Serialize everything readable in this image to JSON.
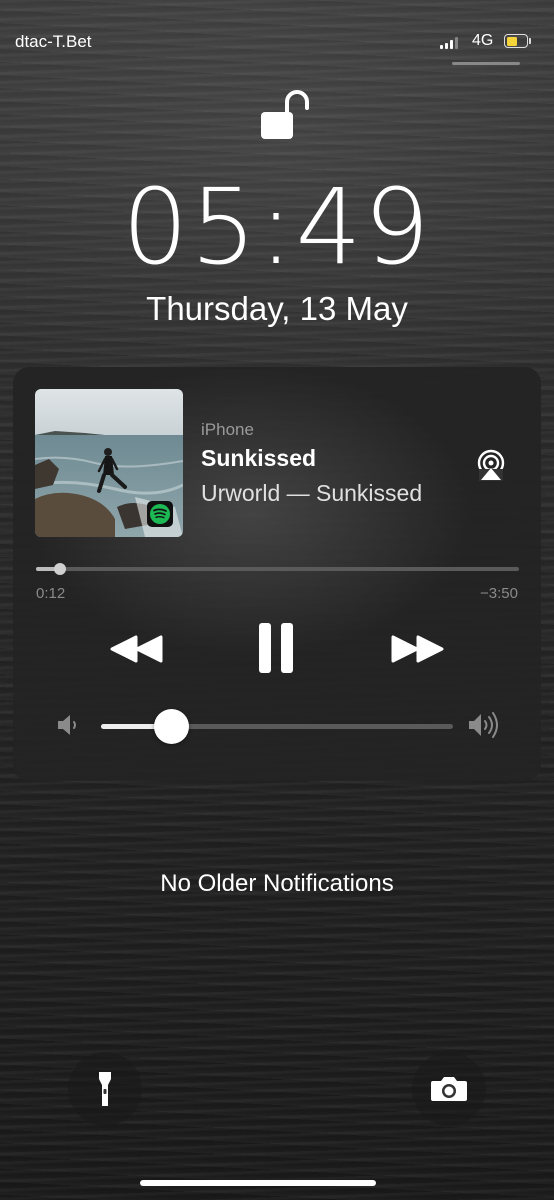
{
  "status_bar": {
    "carrier": "dtac-T.Bet",
    "network": "4G",
    "battery_color": "#f5d33b"
  },
  "lock_screen": {
    "lock_icon": "unlocked-padlock-icon",
    "time": "05:49",
    "date": "Thursday, 13 May"
  },
  "now_playing": {
    "device": "iPhone",
    "title": "Sunkissed",
    "subtitle": "Urworld — Sunkissed",
    "app_badge": "spotify-icon",
    "elapsed": "0:12",
    "remaining": "−3:50",
    "progress_fraction": 0.05,
    "volume_fraction": 0.2
  },
  "notifications": {
    "empty_text": "No Older Notifications"
  },
  "quick_actions": {
    "left": "flashlight-icon",
    "right": "camera-icon"
  }
}
